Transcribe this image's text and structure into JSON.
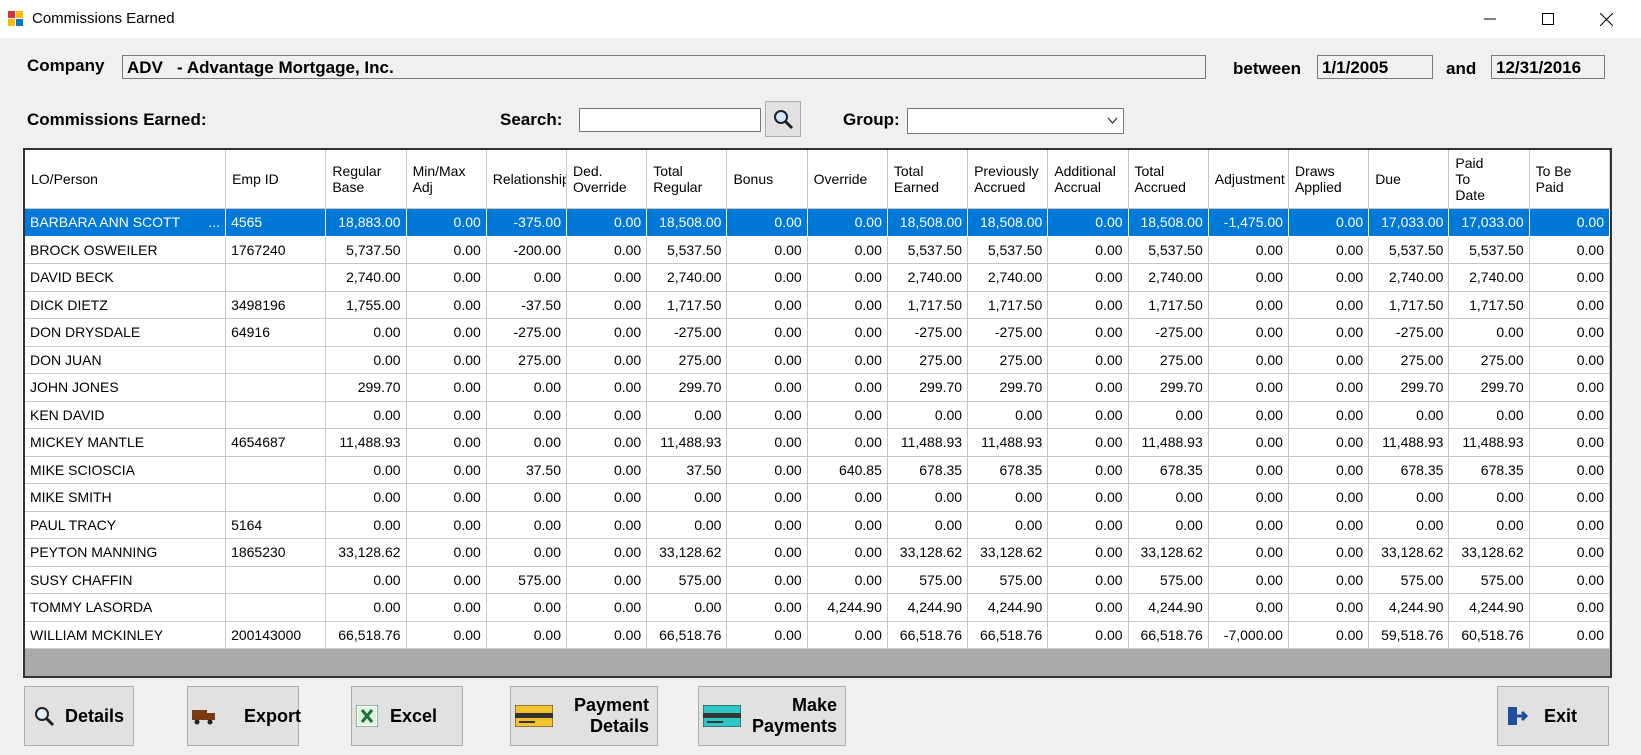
{
  "window": {
    "title": "Commissions Earned"
  },
  "header": {
    "company_label": "Company",
    "company_value": "ADV   - Advantage Mortgage, Inc.",
    "between_label": "between",
    "start_date": "1/1/2005",
    "and_label": "and",
    "end_date": "12/31/2016"
  },
  "toolbar": {
    "section_label": "Commissions Earned:",
    "search_label": "Search:",
    "search_value": "",
    "group_label": "Group:",
    "group_value": ""
  },
  "grid": {
    "columns": [
      "LO/Person",
      "Emp ID",
      "Regular\nBase",
      "Min/Max\nAdj",
      "Relationship",
      "Ded.\nOverride",
      "Total\nRegular",
      "Bonus",
      "Override",
      "Total\nEarned",
      "Previously\nAccrued",
      "Additional\nAccrual",
      "Total\nAccrued",
      "Adjustment",
      "Draws\nApplied",
      "Due",
      "Paid\nTo\nDate",
      "To Be\nPaid"
    ],
    "rows": [
      [
        "BARBARA ANN SCOTT",
        "4565",
        "18,883.00",
        "0.00",
        "-375.00",
        "0.00",
        "18,508.00",
        "0.00",
        "0.00",
        "18,508.00",
        "18,508.00",
        "0.00",
        "18,508.00",
        "-1,475.00",
        "0.00",
        "17,033.00",
        "17,033.00",
        "0.00"
      ],
      [
        "BROCK OSWEILER",
        "1767240",
        "5,737.50",
        "0.00",
        "-200.00",
        "0.00",
        "5,537.50",
        "0.00",
        "0.00",
        "5,537.50",
        "5,537.50",
        "0.00",
        "5,537.50",
        "0.00",
        "0.00",
        "5,537.50",
        "5,537.50",
        "0.00"
      ],
      [
        "DAVID BECK",
        "",
        "2,740.00",
        "0.00",
        "0.00",
        "0.00",
        "2,740.00",
        "0.00",
        "0.00",
        "2,740.00",
        "2,740.00",
        "0.00",
        "2,740.00",
        "0.00",
        "0.00",
        "2,740.00",
        "2,740.00",
        "0.00"
      ],
      [
        "DICK DIETZ",
        "3498196",
        "1,755.00",
        "0.00",
        "-37.50",
        "0.00",
        "1,717.50",
        "0.00",
        "0.00",
        "1,717.50",
        "1,717.50",
        "0.00",
        "1,717.50",
        "0.00",
        "0.00",
        "1,717.50",
        "1,717.50",
        "0.00"
      ],
      [
        "DON DRYSDALE",
        "64916",
        "0.00",
        "0.00",
        "-275.00",
        "0.00",
        "-275.00",
        "0.00",
        "0.00",
        "-275.00",
        "-275.00",
        "0.00",
        "-275.00",
        "0.00",
        "0.00",
        "-275.00",
        "0.00",
        "0.00"
      ],
      [
        "DON JUAN",
        "",
        "0.00",
        "0.00",
        "275.00",
        "0.00",
        "275.00",
        "0.00",
        "0.00",
        "275.00",
        "275.00",
        "0.00",
        "275.00",
        "0.00",
        "0.00",
        "275.00",
        "275.00",
        "0.00"
      ],
      [
        "JOHN JONES",
        "",
        "299.70",
        "0.00",
        "0.00",
        "0.00",
        "299.70",
        "0.00",
        "0.00",
        "299.70",
        "299.70",
        "0.00",
        "299.70",
        "0.00",
        "0.00",
        "299.70",
        "299.70",
        "0.00"
      ],
      [
        "KEN DAVID",
        "",
        "0.00",
        "0.00",
        "0.00",
        "0.00",
        "0.00",
        "0.00",
        "0.00",
        "0.00",
        "0.00",
        "0.00",
        "0.00",
        "0.00",
        "0.00",
        "0.00",
        "0.00",
        "0.00"
      ],
      [
        "MICKEY MANTLE",
        "4654687",
        "11,488.93",
        "0.00",
        "0.00",
        "0.00",
        "11,488.93",
        "0.00",
        "0.00",
        "11,488.93",
        "11,488.93",
        "0.00",
        "11,488.93",
        "0.00",
        "0.00",
        "11,488.93",
        "11,488.93",
        "0.00"
      ],
      [
        "MIKE SCIOSCIA",
        "",
        "0.00",
        "0.00",
        "37.50",
        "0.00",
        "37.50",
        "0.00",
        "640.85",
        "678.35",
        "678.35",
        "0.00",
        "678.35",
        "0.00",
        "0.00",
        "678.35",
        "678.35",
        "0.00"
      ],
      [
        "MIKE SMITH",
        "",
        "0.00",
        "0.00",
        "0.00",
        "0.00",
        "0.00",
        "0.00",
        "0.00",
        "0.00",
        "0.00",
        "0.00",
        "0.00",
        "0.00",
        "0.00",
        "0.00",
        "0.00",
        "0.00"
      ],
      [
        "PAUL TRACY",
        "5164",
        "0.00",
        "0.00",
        "0.00",
        "0.00",
        "0.00",
        "0.00",
        "0.00",
        "0.00",
        "0.00",
        "0.00",
        "0.00",
        "0.00",
        "0.00",
        "0.00",
        "0.00",
        "0.00"
      ],
      [
        "PEYTON MANNING",
        "1865230",
        "33,128.62",
        "0.00",
        "0.00",
        "0.00",
        "33,128.62",
        "0.00",
        "0.00",
        "33,128.62",
        "33,128.62",
        "0.00",
        "33,128.62",
        "0.00",
        "0.00",
        "33,128.62",
        "33,128.62",
        "0.00"
      ],
      [
        "SUSY CHAFFIN",
        "",
        "0.00",
        "0.00",
        "575.00",
        "0.00",
        "575.00",
        "0.00",
        "0.00",
        "575.00",
        "575.00",
        "0.00",
        "575.00",
        "0.00",
        "0.00",
        "575.00",
        "575.00",
        "0.00"
      ],
      [
        "TOMMY LASORDA",
        "",
        "0.00",
        "0.00",
        "0.00",
        "0.00",
        "0.00",
        "0.00",
        "4,244.90",
        "4,244.90",
        "4,244.90",
        "0.00",
        "4,244.90",
        "0.00",
        "0.00",
        "4,244.90",
        "4,244.90",
        "0.00"
      ],
      [
        "WILLIAM MCKINLEY",
        "200143000",
        "66,518.76",
        "0.00",
        "0.00",
        "0.00",
        "66,518.76",
        "0.00",
        "0.00",
        "66,518.76",
        "66,518.76",
        "0.00",
        "66,518.76",
        "-7,000.00",
        "0.00",
        "59,518.76",
        "60,518.76",
        "0.00"
      ]
    ],
    "selected_row": 0,
    "selected_ellipsis": "..."
  },
  "buttons": {
    "details": "Details",
    "export": "Export",
    "excel": "Excel",
    "payment_details": "Payment\nDetails",
    "make_payments": "Make\nPayments",
    "exit": "Exit"
  },
  "colors": {
    "selection": "#0078d7",
    "grid_empty": "#aaaaaa"
  },
  "icons": [
    "app-icon",
    "minimize-icon",
    "maximize-icon",
    "close-icon",
    "search-icon",
    "chevron-down-icon",
    "magnifier-icon",
    "truck-icon",
    "excel-icon",
    "card-icon",
    "card-icon",
    "exit-icon"
  ]
}
